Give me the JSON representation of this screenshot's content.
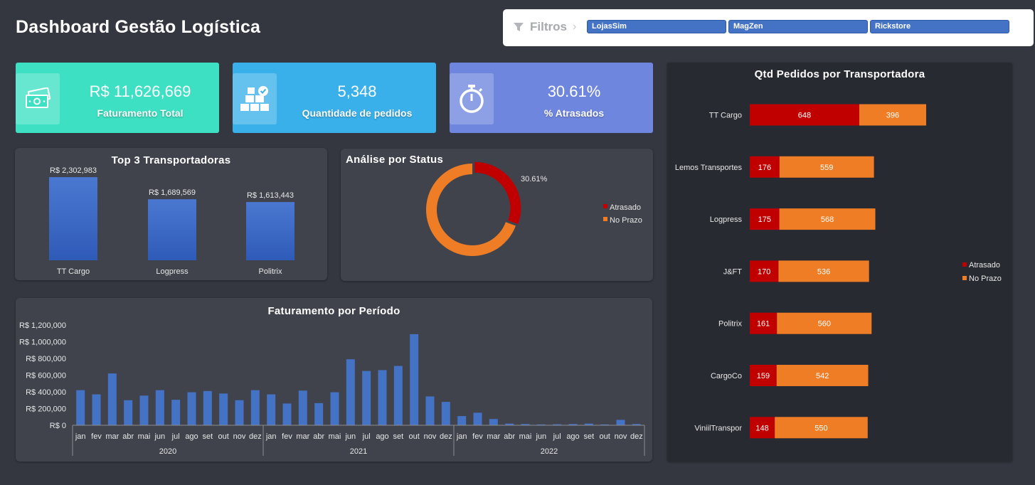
{
  "header": {
    "title": "Dashboard Gestão Logística"
  },
  "filters": {
    "label": "Filtros",
    "slicers": [
      "LojasSim",
      "MagZen",
      "Rickstore"
    ]
  },
  "kpis": [
    {
      "value": "R$ 11,626,669",
      "label": "Faturamento Total",
      "icon": "money-icon",
      "color": "#3de0c2"
    },
    {
      "value": "5,348",
      "label": "Quantidade de pedidos",
      "icon": "boxes-icon",
      "color": "#3ab0ea"
    },
    {
      "value": "30.61%",
      "label": "% Atrasados",
      "icon": "stopwatch-icon",
      "color": "#6f86de"
    }
  ],
  "colors": {
    "atrasado": "#c00000",
    "no_prazo": "#ee7d25",
    "bar_blue": "#4472c4"
  },
  "chart_data": [
    {
      "type": "bar",
      "title": "Top 3 Transportadoras",
      "categories": [
        "TT Cargo",
        "Logpress",
        "Politrix"
      ],
      "values": [
        2302983,
        1689569,
        1613443
      ],
      "data_labels": [
        "R$ 2,302,983",
        "R$ 1,689,569",
        "R$ 1,613,443"
      ],
      "ylim": [
        0,
        2600000
      ]
    },
    {
      "type": "pie",
      "title": "Análise por Status",
      "labels": [
        "Atrasado",
        "No Prazo"
      ],
      "values": [
        30.61,
        69.39
      ],
      "data_label": "30.61%",
      "legend": "right"
    },
    {
      "type": "bar",
      "title": "Faturamento por Período",
      "x": [
        "jan",
        "fev",
        "mar",
        "abr",
        "mai",
        "jun",
        "jul",
        "ago",
        "set",
        "out",
        "nov",
        "dez"
      ],
      "groups": [
        "2020",
        "2021",
        "2022"
      ],
      "values": [
        420000,
        370000,
        620000,
        300000,
        355000,
        420000,
        305000,
        395000,
        410000,
        380000,
        300000,
        420000,
        370000,
        260000,
        415000,
        265000,
        395000,
        790000,
        650000,
        660000,
        710000,
        1090000,
        345000,
        280000,
        110000,
        150000,
        75000,
        20000,
        15000,
        10000,
        12000,
        15000,
        20000,
        10000,
        65000,
        15000
      ],
      "yticks": [
        "R$ 0",
        "R$ 200,000",
        "R$ 400,000",
        "R$ 600,000",
        "R$ 800,000",
        "R$ 1,000,000",
        "R$ 1,200,000"
      ],
      "ylim": [
        0,
        1200000
      ]
    },
    {
      "type": "bar",
      "orientation": "horizontal",
      "stacked": true,
      "title": "Qtd Pedidos por Transportadora",
      "categories": [
        "TT Cargo",
        "Lemos Transportes",
        "Logpress",
        "J&FT",
        "Politrix",
        "CargoCo",
        "ViniilTranspor"
      ],
      "series": [
        {
          "name": "Atrasado",
          "values": [
            648,
            176,
            175,
            170,
            161,
            159,
            148
          ]
        },
        {
          "name": "No Prazo",
          "values": [
            396,
            559,
            568,
            536,
            560,
            542,
            550
          ]
        }
      ],
      "legend": "right"
    }
  ]
}
